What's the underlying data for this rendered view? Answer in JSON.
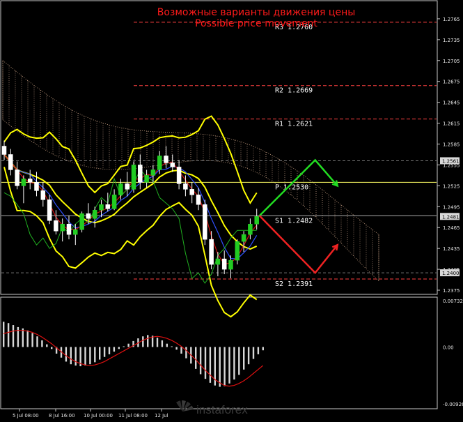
{
  "chart_data": {
    "type": "candlestick",
    "title": "Возможные варианты движения цены",
    "subtitle": "Possible price movement",
    "price_axis": {
      "ylim": [
        1.237,
        1.279
      ],
      "ticks": [
        "1.2375",
        "1.2405",
        "1.2435",
        "1.2465",
        "1.2495",
        "1.2525",
        "1.2555",
        "1.2585",
        "1.2615",
        "1.2645",
        "1.2675",
        "1.2705",
        "1.2735",
        "1.2765",
        "1.2795"
      ]
    },
    "time_axis": {
      "labels": [
        "5 Jul 08:00",
        "8 Jul 16:00",
        "10 Jul 00:00",
        "11 Jul 08:00",
        "12 Jul"
      ]
    },
    "levels": [
      {
        "label": "R3 1.2760",
        "value": 1.276,
        "color": "#ff4040"
      },
      {
        "label": "R2 1.2669",
        "value": 1.2669,
        "color": "#ff4040"
      },
      {
        "label": "R1 1.2621",
        "value": 1.2621,
        "color": "#ff4040"
      },
      {
        "label": "P 1.2530",
        "value": 1.253,
        "color": "#ffff66"
      },
      {
        "label": "S1 1.2482",
        "value": 1.2482,
        "color": "#aaaaaa"
      },
      {
        "label": "S2 1.2391",
        "value": 1.2391,
        "color": "#ff4040"
      }
    ],
    "price_tags": [
      {
        "label": "1.2561",
        "value": 1.2561
      },
      {
        "label": "1.2481",
        "value": 1.2481
      },
      {
        "label": "1.2400",
        "value": 1.24
      }
    ],
    "candles": [
      [
        1.2582,
        1.259,
        1.2562,
        1.257
      ],
      [
        1.257,
        1.2578,
        1.254,
        1.2548
      ],
      [
        1.2548,
        1.256,
        1.252,
        1.2525
      ],
      [
        1.2525,
        1.254,
        1.25,
        1.2535
      ],
      [
        1.2535,
        1.2548,
        1.252,
        1.253
      ],
      [
        1.253,
        1.2545,
        1.251,
        1.2518
      ],
      [
        1.2518,
        1.253,
        1.2495,
        1.2505
      ],
      [
        1.2505,
        1.2512,
        1.247,
        1.2475
      ],
      [
        1.2475,
        1.249,
        1.2455,
        1.246
      ],
      [
        1.246,
        1.2478,
        1.2445,
        1.247
      ],
      [
        1.247,
        1.2482,
        1.2448,
        1.2455
      ],
      [
        1.2455,
        1.247,
        1.244,
        1.2462
      ],
      [
        1.2462,
        1.2488,
        1.2458,
        1.2485
      ],
      [
        1.2485,
        1.25,
        1.247,
        1.2478
      ],
      [
        1.2478,
        1.2495,
        1.2465,
        1.249
      ],
      [
        1.249,
        1.2505,
        1.248,
        1.2498
      ],
      [
        1.2498,
        1.2515,
        1.2488,
        1.2492
      ],
      [
        1.2492,
        1.252,
        1.249,
        1.2512
      ],
      [
        1.2512,
        1.2535,
        1.2505,
        1.2528
      ],
      [
        1.2528,
        1.2545,
        1.251,
        1.252
      ],
      [
        1.252,
        1.256,
        1.2515,
        1.2555
      ],
      [
        1.2555,
        1.257,
        1.252,
        1.253
      ],
      [
        1.253,
        1.2548,
        1.2522,
        1.254
      ],
      [
        1.254,
        1.2555,
        1.253,
        1.2548
      ],
      [
        1.2548,
        1.2575,
        1.2542,
        1.2568
      ],
      [
        1.2568,
        1.2582,
        1.255,
        1.2558
      ],
      [
        1.2558,
        1.257,
        1.2545,
        1.2552
      ],
      [
        1.2552,
        1.2562,
        1.252,
        1.2528
      ],
      [
        1.2528,
        1.254,
        1.251,
        1.252
      ],
      [
        1.252,
        1.253,
        1.25,
        1.2512
      ],
      [
        1.2512,
        1.2522,
        1.249,
        1.2498
      ],
      [
        1.2498,
        1.2505,
        1.244,
        1.2448
      ],
      [
        1.2448,
        1.246,
        1.2405,
        1.2412
      ],
      [
        1.2412,
        1.243,
        1.2395,
        1.242
      ],
      [
        1.242,
        1.2432,
        1.2398,
        1.2405
      ],
      [
        1.2405,
        1.2425,
        1.2392,
        1.2418
      ],
      [
        1.2418,
        1.2448,
        1.2412,
        1.2445
      ],
      [
        1.2445,
        1.246,
        1.243,
        1.2455
      ],
      [
        1.2455,
        1.2478,
        1.2448,
        1.247
      ],
      [
        1.247,
        1.2492,
        1.2462,
        1.2481
      ]
    ],
    "scenarios": [
      {
        "name": "up",
        "color": "#22dd22",
        "points": [
          [
            1.2482,
            0
          ],
          [
            1.2562,
            1
          ],
          [
            1.2525,
            1.4
          ]
        ]
      },
      {
        "name": "down",
        "color": "#ee2222",
        "points": [
          [
            1.2482,
            0
          ],
          [
            1.24,
            1
          ],
          [
            1.244,
            1.4
          ]
        ]
      }
    ],
    "oscillator": {
      "ylim": [
        -0.0092,
        0.0073
      ],
      "ticks": [
        "0.00732",
        "0.00",
        "-0.00926"
      ],
      "zero": 0.0,
      "histogram": [
        0.0038,
        0.0036,
        0.0033,
        0.003,
        0.0028,
        0.0025,
        0.0021,
        0.0016,
        0.001,
        0.0004,
        -0.0003,
        -0.001,
        -0.0016,
        -0.0022,
        -0.0026,
        -0.0028,
        -0.0029,
        -0.0028,
        -0.0026,
        -0.0023,
        -0.0019,
        -0.0015,
        -0.0011,
        -0.0007,
        -0.0003,
        0.0001,
        0.0005,
        0.0009,
        0.0013,
        0.0016,
        0.0018,
        0.0017,
        0.0014,
        0.001,
        0.0005,
        0.0001,
        -0.0004,
        -0.001,
        -0.0017,
        -0.0025,
        -0.0033,
        -0.0041,
        -0.0048,
        -0.0054,
        -0.0058,
        -0.006,
        -0.0059,
        -0.0055,
        -0.0049,
        -0.0042,
        -0.0034,
        -0.0026,
        -0.0018,
        -0.0011,
        -0.0005
      ],
      "signal": [
        0.002,
        0.0022,
        0.0024,
        0.0025,
        0.0025,
        0.0024,
        0.0022,
        0.0019,
        0.0015,
        0.001,
        0.0005,
        -0.0001,
        -0.0007,
        -0.0013,
        -0.0018,
        -0.0022,
        -0.0025,
        -0.0027,
        -0.0028,
        -0.0027,
        -0.0025,
        -0.0022,
        -0.0018,
        -0.0014,
        -0.001,
        -0.0006,
        -0.0002,
        0.0002,
        0.0006,
        0.001,
        0.0013,
        0.0015,
        0.0016,
        0.0015,
        0.0013,
        0.001,
        0.0006,
        0.0001,
        -0.0005,
        -0.0012,
        -0.0019,
        -0.0027,
        -0.0035,
        -0.0042,
        -0.0049,
        -0.0054,
        -0.0058,
        -0.0059,
        -0.0058,
        -0.0055,
        -0.0051,
        -0.0046,
        -0.004,
        -0.0034,
        -0.0028
      ]
    }
  },
  "branding": {
    "logo_text": "instaforex",
    "logo_icon": "instaforex-fan-icon"
  }
}
